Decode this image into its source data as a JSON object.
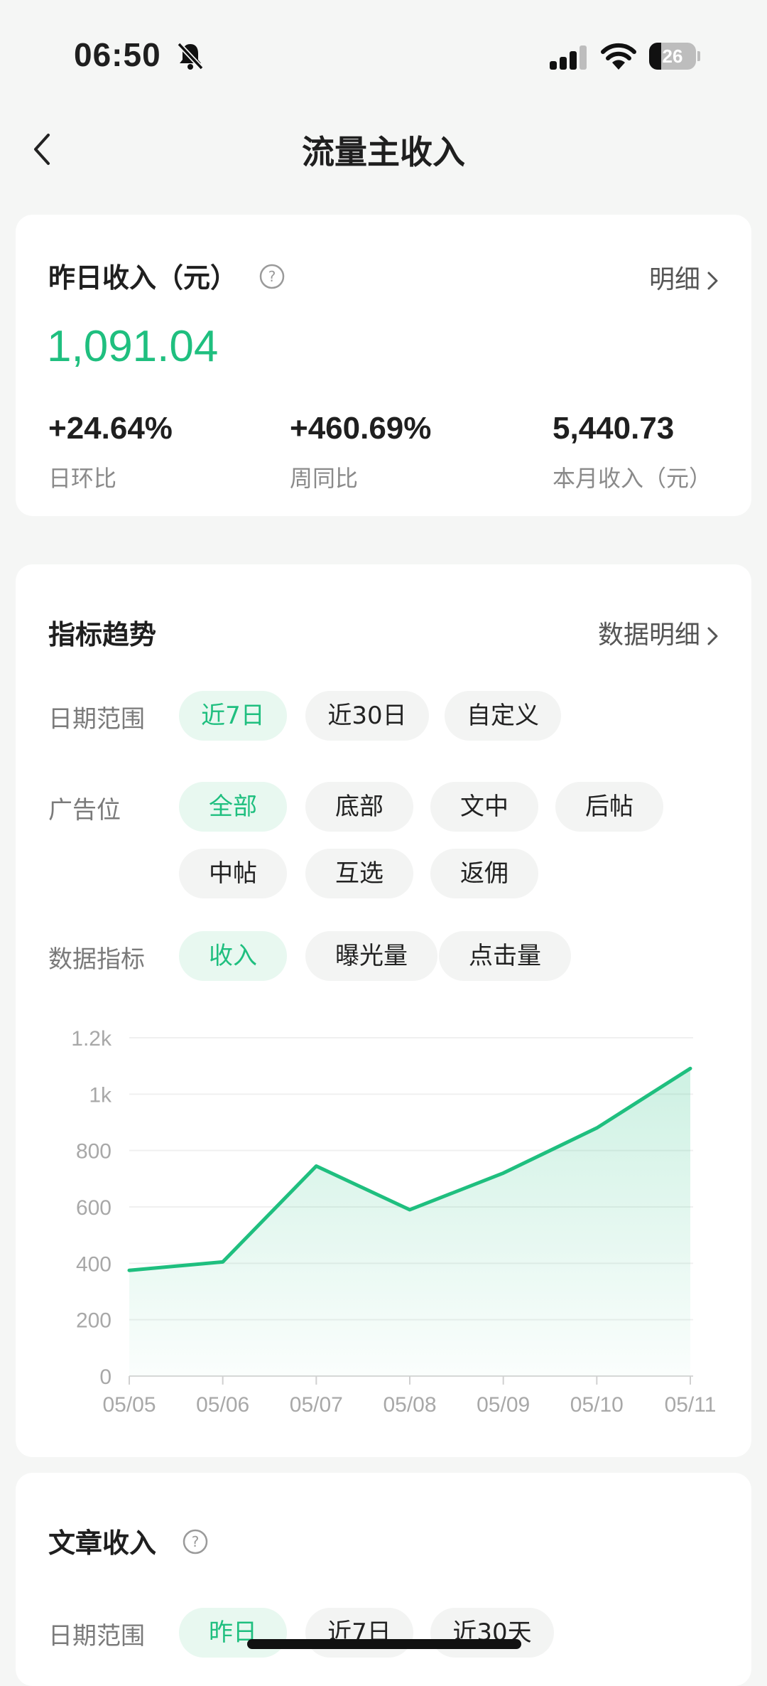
{
  "status_bar": {
    "time": "06:50",
    "battery": "26",
    "battery_level": 0.26
  },
  "nav": {
    "title": "流量主收入"
  },
  "summary": {
    "label": "昨日收入（元）",
    "detail_link": "明细",
    "value": "1,091.04",
    "stats": [
      {
        "value": "+24.64%",
        "label": "日环比"
      },
      {
        "value": "+460.69%",
        "label": "周同比"
      },
      {
        "value": "5,440.73",
        "label": "本月收入（元）"
      }
    ]
  },
  "trend": {
    "title": "指标趋势",
    "detail_link": "数据明细",
    "date_range": {
      "label": "日期范围",
      "options": [
        "近7日",
        "近30日",
        "自定义"
      ],
      "selected": "近7日"
    },
    "ad_slot": {
      "label": "广告位",
      "options": [
        "全部",
        "底部",
        "文中",
        "后帖",
        "中帖",
        "互选",
        "返佣"
      ],
      "selected": "全部"
    },
    "metric": {
      "label": "数据指标",
      "options": [
        "收入",
        "曝光量",
        "点击量"
      ],
      "selected": "收入"
    }
  },
  "chart_data": {
    "type": "area",
    "x": [
      "05/05",
      "05/06",
      "05/07",
      "05/08",
      "05/09",
      "05/10",
      "05/11"
    ],
    "series": [
      {
        "values": [
          375,
          405,
          745,
          590,
          720,
          880,
          1091.04
        ]
      }
    ],
    "y_ticks": [
      "0",
      "200",
      "400",
      "600",
      "800",
      "1k",
      "1.2k"
    ],
    "ylim": [
      0,
      1200
    ],
    "grid": true,
    "color": "#1fbf7f"
  },
  "article": {
    "title": "文章收入",
    "date_range": {
      "label": "日期范围",
      "options": [
        "昨日",
        "近7日",
        "近30天"
      ],
      "selected": "昨日"
    }
  },
  "colors": {
    "accent": "#1fbf7f",
    "background": "#f5f6f5"
  }
}
